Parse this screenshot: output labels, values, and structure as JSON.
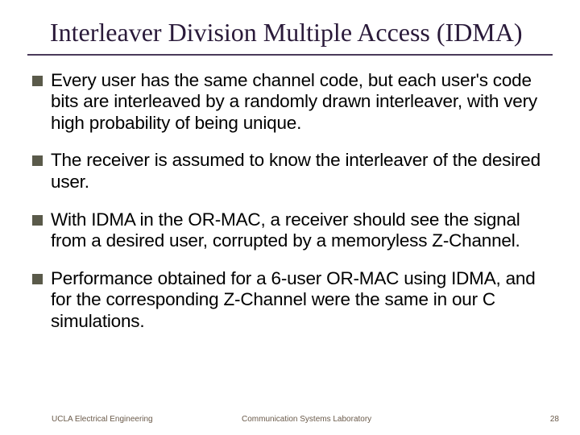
{
  "title": "Interleaver Division Multiple Access (IDMA)",
  "bullets": [
    "Every user has the same channel code, but each user's code bits are interleaved by a randomly drawn interleaver, with very high probability of being unique.",
    "The receiver is assumed to know the interleaver of the desired user.",
    "With IDMA in the OR-MAC, a receiver should see the signal from a desired user, corrupted by a memoryless Z-Channel.",
    "Performance obtained for a 6-user OR-MAC using IDMA, and for the corresponding Z-Channel were the same in our C simulations."
  ],
  "footer": {
    "left": "UCLA Electrical Engineering",
    "center": "Communication Systems Laboratory",
    "page": "28"
  }
}
